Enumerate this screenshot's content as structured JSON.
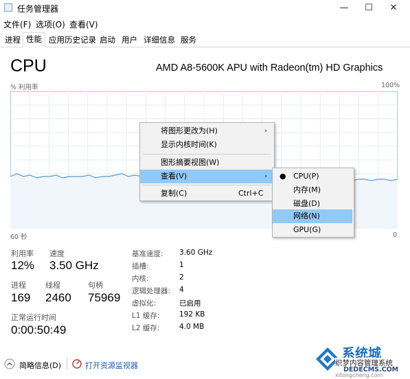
{
  "window": {
    "title": "任务管理器",
    "minimize": "—",
    "maximize": "☐",
    "close": "✕"
  },
  "menu": [
    "文件(F)",
    "选项(O)",
    "查看(V)"
  ],
  "tabs": [
    "进程",
    "性能",
    "应用历史记录",
    "启动",
    "用户",
    "详细信息",
    "服务"
  ],
  "active_tab": "性能",
  "cpu": {
    "title": "CPU",
    "model": "AMD A8-5600K APU with Radeon(tm) HD Graphics",
    "y_label": "% 利用率",
    "y_max": "100%",
    "x_left": "60 秒",
    "x_right": "0"
  },
  "chart_data": {
    "type": "area",
    "y_range": [
      0,
      100
    ],
    "x_range": [
      60,
      0
    ],
    "values": [
      38,
      40,
      38,
      39,
      37,
      38,
      38,
      39,
      37,
      38,
      38,
      38,
      39,
      37,
      38,
      38,
      39,
      40,
      38,
      39,
      38,
      38,
      37,
      38,
      38,
      39,
      38,
      37,
      38,
      39,
      38,
      38,
      37,
      38,
      39,
      38,
      38,
      37,
      38,
      38,
      37,
      38,
      37,
      37,
      38,
      35,
      36,
      36,
      35,
      36,
      36,
      35,
      35,
      36,
      36,
      35,
      36,
      36,
      35,
      36
    ]
  },
  "stats": {
    "utilization_label": "利用率",
    "utilization": "12%",
    "speed_label": "速度",
    "speed": "3.50 GHz",
    "processes_label": "进程",
    "processes": "169",
    "threads_label": "线程",
    "threads": "2460",
    "handles_label": "句柄",
    "handles": "75969",
    "uptime_label": "正常运行时间",
    "uptime": "0:00:50:49"
  },
  "details": [
    {
      "k": "基准速度:",
      "v": "3.60 GHz"
    },
    {
      "k": "插槽:",
      "v": "1"
    },
    {
      "k": "内核:",
      "v": "2"
    },
    {
      "k": "逻辑处理器:",
      "v": "4"
    },
    {
      "k": "虚拟化:",
      "v": "已启用"
    },
    {
      "k": "L1 缓存:",
      "v": "192 KB"
    },
    {
      "k": "L2 缓存:",
      "v": "4.0 MB"
    }
  ],
  "context_menu": {
    "items": [
      {
        "label": "将图形更改为(H)",
        "submenu": true
      },
      {
        "label": "显示内核时间(K)"
      },
      {
        "label": "图形摘要视图(W)"
      },
      {
        "label": "查看(V)",
        "submenu": true,
        "highlighted": true
      },
      {
        "label": "复制(C)",
        "shortcut": "Ctrl+C"
      }
    ]
  },
  "submenu": {
    "items": [
      {
        "label": "CPU(P)",
        "checked": true
      },
      {
        "label": "内存(M)"
      },
      {
        "label": "磁盘(D)"
      },
      {
        "label": "网络(N)",
        "highlighted": true
      },
      {
        "label": "GPU(G)"
      }
    ]
  },
  "footer": {
    "summary": "简略信息(D)",
    "resource_monitor": "打开资源监视器"
  },
  "watermark": {
    "line1": "系统城",
    "line2": "织梦内容管理系统",
    "line3": "DEDECMS.COM",
    "line4": "xitongcheng.com"
  },
  "colors": {
    "graph_line": "#4e9dd4",
    "graph_fill": "#f1f6fb",
    "grid": "#d9e8f5",
    "highlight": "#91c9f7"
  }
}
